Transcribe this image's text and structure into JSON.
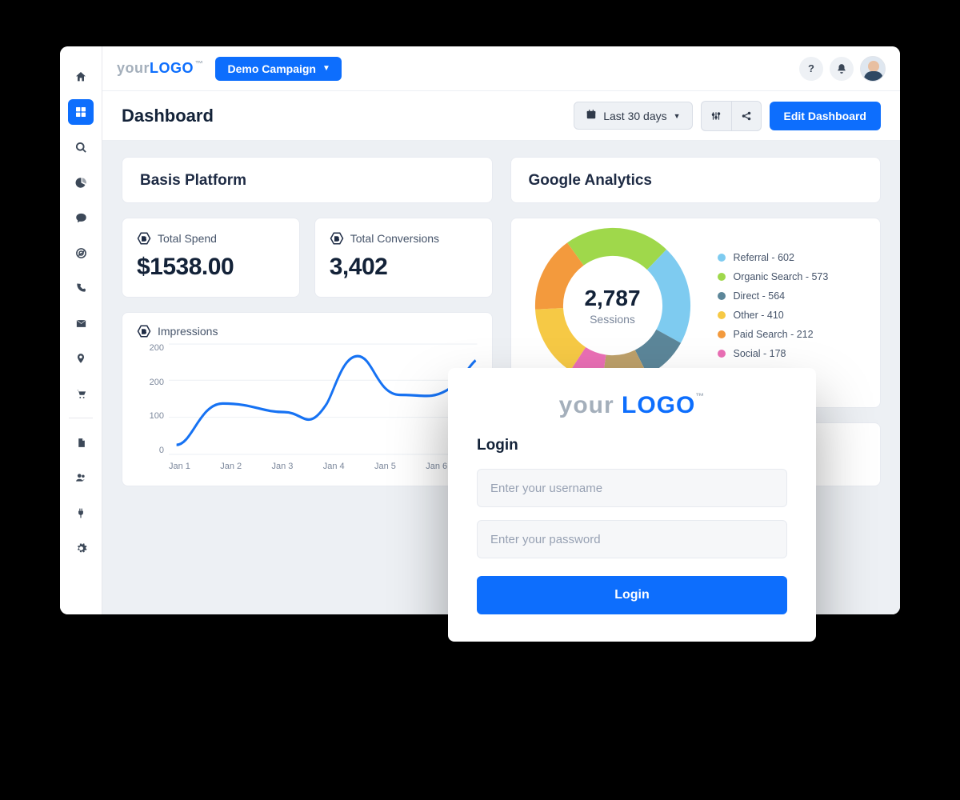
{
  "logo": {
    "prefix": "your",
    "word": "LOGO",
    "tm": "™"
  },
  "campaign": {
    "label": "Demo Campaign"
  },
  "page": {
    "title": "Dashboard"
  },
  "toolbar": {
    "date_range_label": "Last 30 days",
    "edit_label": "Edit Dashboard"
  },
  "basis": {
    "title": "Basis Platform",
    "total_spend_label": "Total Spend",
    "total_spend_value": "$1538.00",
    "total_conversions_label": "Total Conversions",
    "total_conversions_value": "3,402",
    "impressions_label": "Impressions"
  },
  "ga": {
    "title": "Google Analytics",
    "center_value": "2,787",
    "center_label": "Sessions"
  },
  "legend": {
    "l0": "Referral - 602",
    "l1": "Organic Search - 573",
    "l2": "Direct - 564",
    "l3": "Other - 410",
    "l4": "Paid Search - 212",
    "l5": "Social - 178"
  },
  "login": {
    "heading": "Login",
    "username_placeholder": "Enter your username",
    "password_placeholder": "Enter your password",
    "button_label": "Login"
  },
  "xax": {
    "x0": "Jan 1",
    "x1": "Jan 2",
    "x2": "Jan 3",
    "x3": "Jan 4",
    "x4": "Jan 5",
    "x5": "Jan 6"
  },
  "yax": {
    "y0": "200",
    "y1": "200",
    "y2": "100",
    "y3": "0"
  },
  "chart_data": [
    {
      "type": "line",
      "title": "Impressions",
      "x": [
        "Jan 1",
        "Jan 2",
        "Jan 3",
        "Jan 4",
        "Jan 5",
        "Jan 6"
      ],
      "values": [
        25,
        100,
        85,
        230,
        130,
        210
      ],
      "ylim": [
        0,
        200
      ],
      "xlabel": "",
      "ylabel": ""
    },
    {
      "type": "pie",
      "title": "Google Analytics Sessions",
      "center_value": 2787,
      "center_label": "Sessions",
      "series": [
        {
          "name": "Referral",
          "value": 602,
          "color": "#7ecbf0"
        },
        {
          "name": "Organic Search",
          "value": 573,
          "color": "#9fd84b"
        },
        {
          "name": "Direct",
          "value": 564,
          "color": "#5c8699"
        },
        {
          "name": "Other",
          "value": 410,
          "color": "#f6c945"
        },
        {
          "name": "Paid Search",
          "value": 212,
          "color": "#f39a3d"
        },
        {
          "name": "Social",
          "value": 178,
          "color": "#ea6fb5"
        }
      ]
    }
  ],
  "colors": {
    "accent": "#0d6efd",
    "donut": [
      "#7ecbf0",
      "#9fd84b",
      "#5c8699",
      "#f6c945",
      "#f39a3d",
      "#ea6fb5",
      "#bda06a"
    ]
  }
}
